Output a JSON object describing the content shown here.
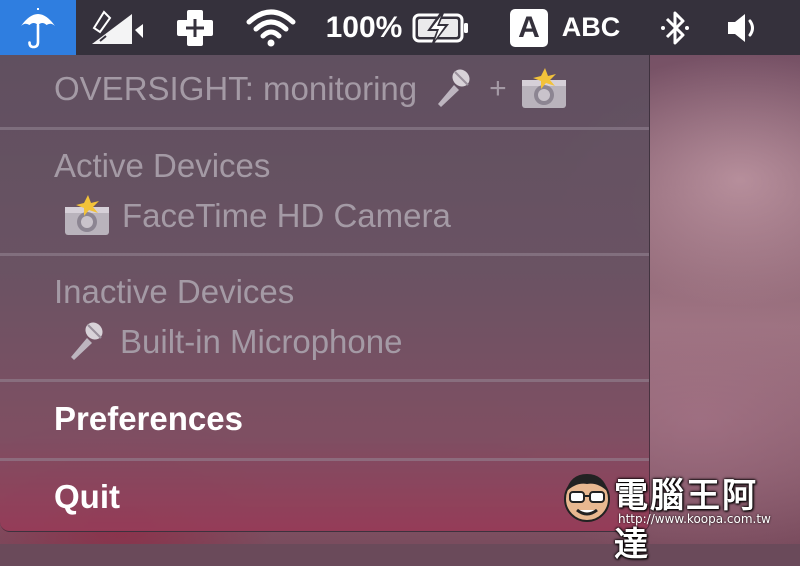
{
  "menubar": {
    "battery_percent": "100%",
    "input_source_letter": "A",
    "input_source_name": "ABC",
    "icons": [
      "umbrella-icon",
      "signal-icon",
      "medical-cross-icon",
      "wifi-icon",
      "battery-charging-icon",
      "bluetooth-icon",
      "volume-icon"
    ],
    "accent_color": "#2f7ee0"
  },
  "menu": {
    "header": {
      "text": "OVERSIGHT: monitoring",
      "plus": "+"
    },
    "active_devices": {
      "title": "Active Devices",
      "items": [
        {
          "label": "FaceTime HD Camera",
          "icon": "camera-icon"
        }
      ]
    },
    "inactive_devices": {
      "title": "Inactive Devices",
      "items": [
        {
          "label": "Built-in Microphone",
          "icon": "microphone-icon"
        }
      ]
    },
    "preferences_label": "Preferences",
    "quit_label": "Quit"
  },
  "watermark": {
    "title": "電腦王阿達",
    "url": "http://www.koopa.com.tw"
  }
}
